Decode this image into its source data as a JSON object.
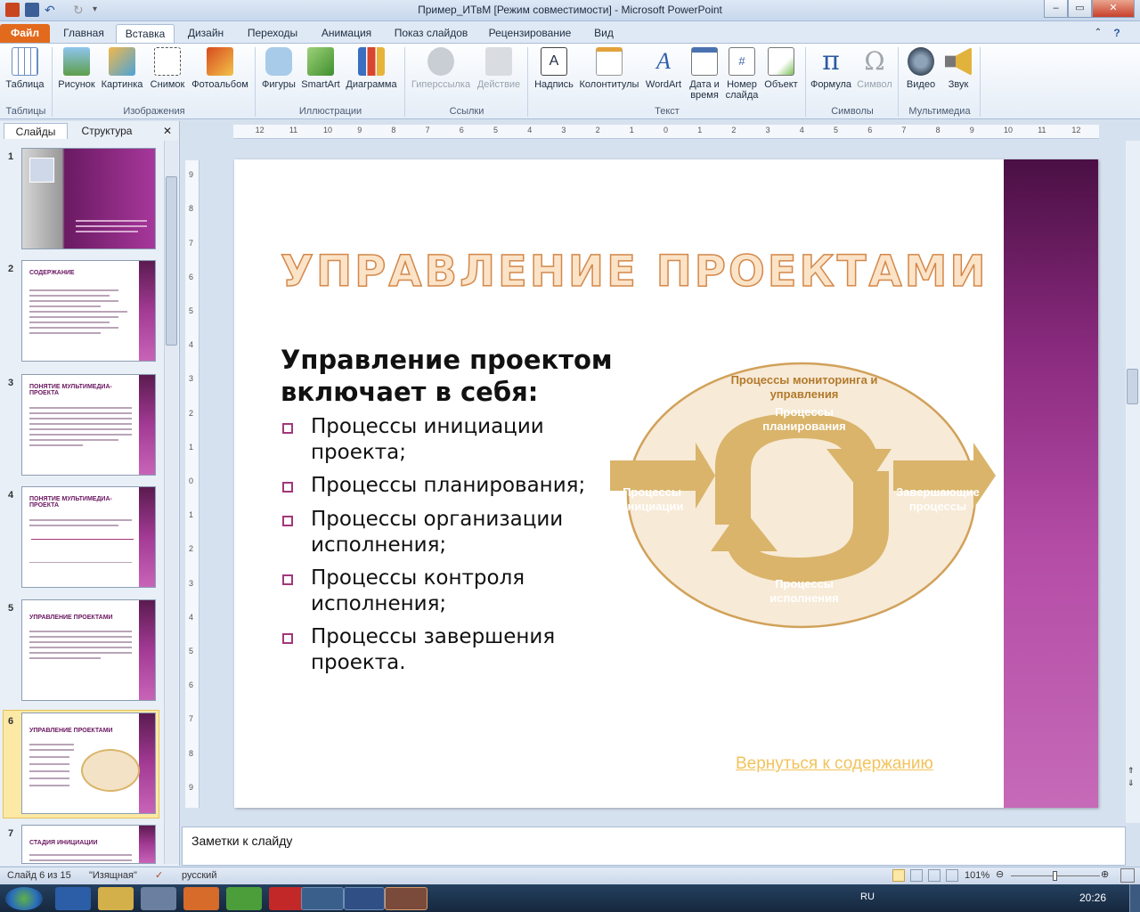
{
  "window": {
    "title": "Пример_ИТвМ [Режим совместимости] - Microsoft PowerPoint",
    "min": "–",
    "max": "▭",
    "close": "✕"
  },
  "tabs": [
    "Файл",
    "Главная",
    "Вставка",
    "Дизайн",
    "Переходы",
    "Анимация",
    "Показ слайдов",
    "Рецензирование",
    "Вид"
  ],
  "ribbon": {
    "buttons": [
      {
        "label": "Таблица",
        "icon": "table-icon",
        "enabled": true
      },
      {
        "label": "Рисунок",
        "icon": "picture-icon",
        "enabled": true
      },
      {
        "label": "Картинка",
        "icon": "clipart-icon",
        "enabled": true
      },
      {
        "label": "Снимок",
        "icon": "screenshot-icon",
        "enabled": true
      },
      {
        "label": "Фотоальбом",
        "icon": "photo-album-icon",
        "enabled": true
      },
      {
        "label": "Фигуры",
        "icon": "shapes-icon",
        "enabled": true
      },
      {
        "label": "SmartArt",
        "icon": "smartart-icon",
        "enabled": true
      },
      {
        "label": "Диаграмма",
        "icon": "chart-icon",
        "enabled": true
      },
      {
        "label": "Гиперссылка",
        "icon": "hyperlink-icon",
        "enabled": false
      },
      {
        "label": "Действие",
        "icon": "action-icon",
        "enabled": false
      },
      {
        "label": "Надпись",
        "icon": "textbox-icon",
        "enabled": true
      },
      {
        "label": "Колонтитулы",
        "icon": "header-footer-icon",
        "enabled": true
      },
      {
        "label": "WordArt",
        "icon": "wordart-icon",
        "enabled": true
      },
      {
        "label": "Дата и время",
        "icon": "datetime-icon",
        "enabled": true
      },
      {
        "label": "Номер слайда",
        "icon": "slide-number-icon",
        "enabled": true
      },
      {
        "label": "Объект",
        "icon": "object-icon",
        "enabled": true
      },
      {
        "label": "Формула",
        "icon": "formula-icon",
        "enabled": true
      },
      {
        "label": "Символ",
        "icon": "symbol-icon",
        "enabled": false
      },
      {
        "label": "Видео",
        "icon": "video-icon",
        "enabled": true
      },
      {
        "label": "Звук",
        "icon": "sound-icon",
        "enabled": true
      }
    ],
    "groups": [
      "Таблицы",
      "Изображения",
      "Иллюстрации",
      "Ссылки",
      "Текст",
      "Символы",
      "Мультимедиа"
    ]
  },
  "left_panel": {
    "tab_slides": "Слайды",
    "tab_outline": "Структура",
    "close": "✕",
    "thumbnails": [
      {
        "num": "1",
        "title": ""
      },
      {
        "num": "2",
        "title": "СОДЕРЖАНИЕ"
      },
      {
        "num": "3",
        "title": "ПОНЯТИЕ МУЛЬТИМЕДИА-ПРОЕКТА"
      },
      {
        "num": "4",
        "title": "ПОНЯТИЕ МУЛЬТИМЕДИА-ПРОЕКТА"
      },
      {
        "num": "5",
        "title": "УПРАВЛЕНИЕ ПРОЕКТАМИ"
      },
      {
        "num": "6",
        "title": "УПРАВЛЕНИЕ ПРОЕКТАМИ"
      },
      {
        "num": "7",
        "title": "СТАДИЯ ИНИЦИАЦИИ"
      }
    ]
  },
  "slide": {
    "title": "УПРАВЛЕНИЕ ПРОЕКТАМИ",
    "heading": "Управление проектом включает в себя:",
    "bullets": [
      "Процессы инициации проекта;",
      "Процессы планирования;",
      "Процессы организации исполнения;",
      "Процессы контроля исполнения;",
      "Процессы завершения проекта."
    ],
    "diagram": {
      "monitoring": "Процессы мониторинга и управления",
      "planning": "Процессы планирования",
      "initiation": "Процессы инициации",
      "closing": "Завершающие процессы",
      "execution": "Процессы исполнения"
    },
    "back_link": "Вернуться к содержанию"
  },
  "notes_placeholder": "Заметки к слайду",
  "status": {
    "slide": "Слайд 6 из 15",
    "theme": "\"Изящная\"",
    "lang": "русский",
    "zoom": "101%"
  },
  "taskbar": {
    "lang": "RU",
    "time": "20:26"
  },
  "colors": {
    "accent": "#a2377a",
    "gold": "#d9b46a",
    "file_tab": "#e26a1d"
  }
}
